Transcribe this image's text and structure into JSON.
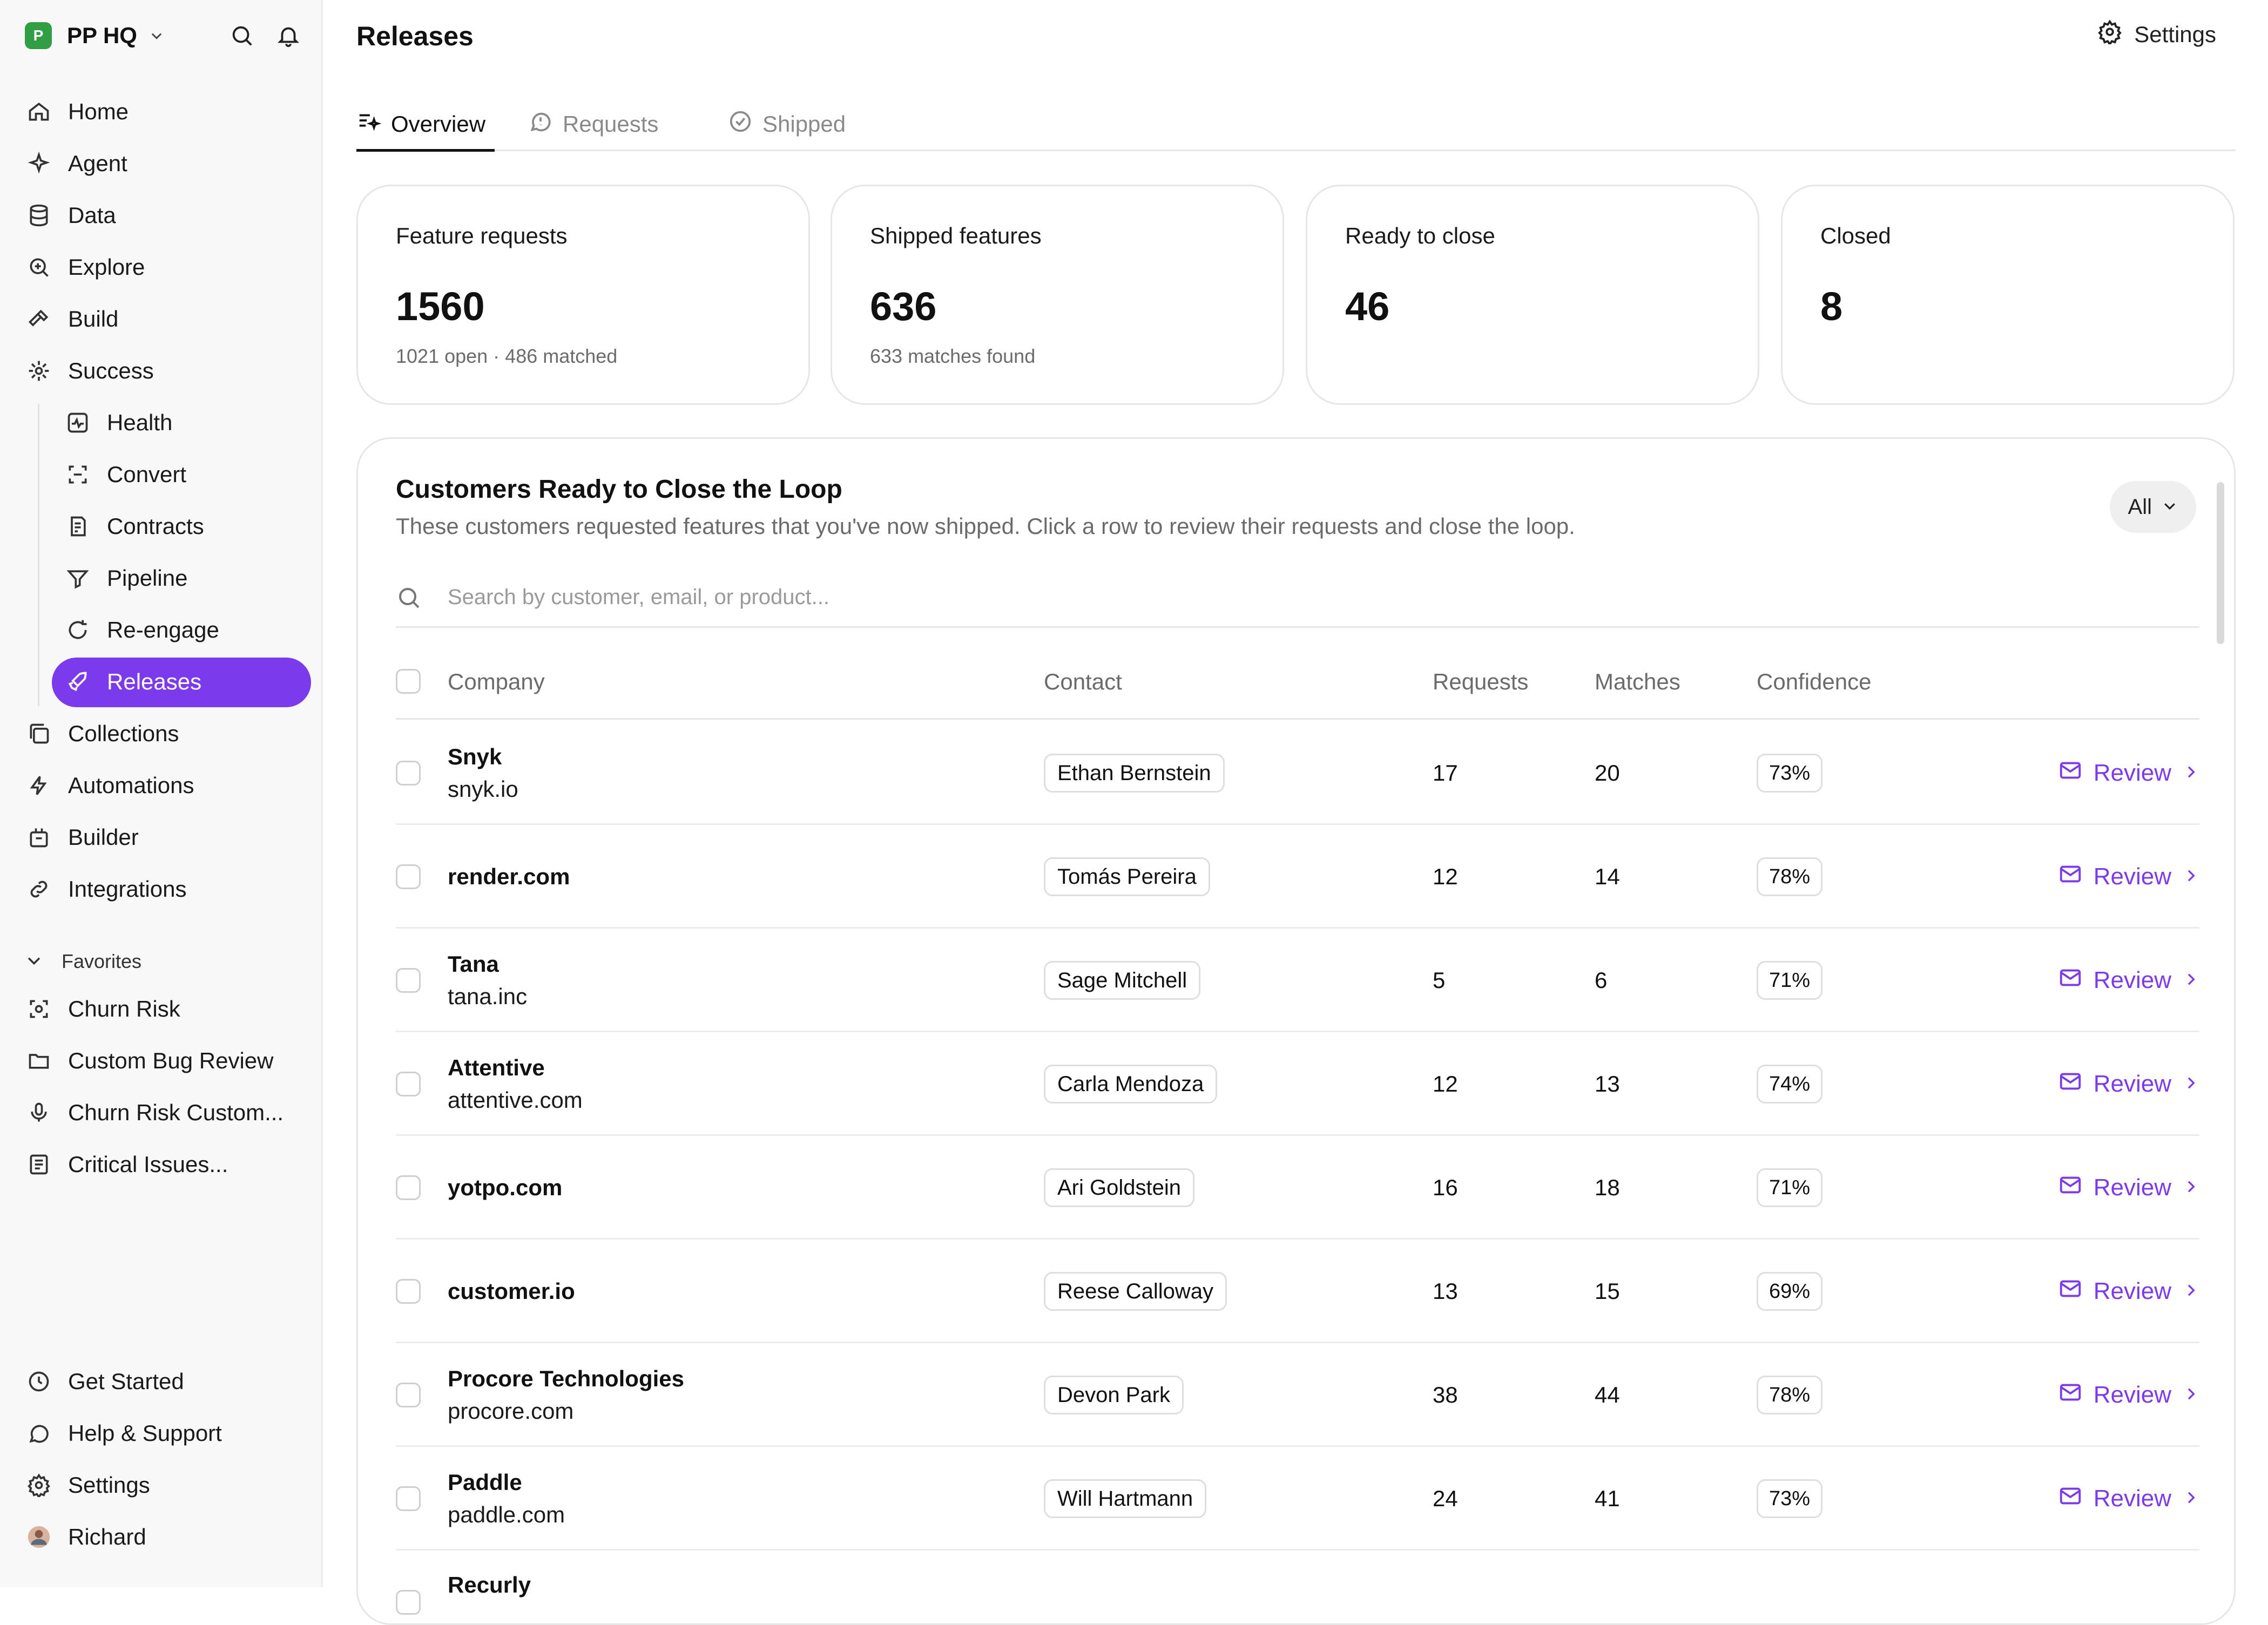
{
  "workspace": {
    "name": "PP HQ",
    "logo_letter": "P"
  },
  "sidebar": {
    "items": [
      {
        "label": "Home",
        "icon": "home-icon"
      },
      {
        "label": "Agent",
        "icon": "sparkle-icon"
      },
      {
        "label": "Data",
        "icon": "database-icon"
      },
      {
        "label": "Explore",
        "icon": "zoom-icon"
      },
      {
        "label": "Build",
        "icon": "hammer-icon"
      },
      {
        "label": "Success",
        "icon": "success-icon"
      }
    ],
    "sub_items": [
      {
        "label": "Health",
        "icon": "pulse-icon"
      },
      {
        "label": "Convert",
        "icon": "convert-icon"
      },
      {
        "label": "Contracts",
        "icon": "contract-icon"
      },
      {
        "label": "Pipeline",
        "icon": "funnel-icon"
      },
      {
        "label": "Re-engage",
        "icon": "reengage-icon"
      },
      {
        "label": "Releases",
        "icon": "rocket-icon",
        "active": true
      }
    ],
    "items2": [
      {
        "label": "Collections",
        "icon": "collections-icon"
      },
      {
        "label": "Automations",
        "icon": "automation-icon"
      },
      {
        "label": "Builder",
        "icon": "builder-icon"
      },
      {
        "label": "Integrations",
        "icon": "link-icon"
      }
    ],
    "favorites_label": "Favorites",
    "favorites": [
      {
        "label": "Churn Risk",
        "icon": "scan-icon"
      },
      {
        "label": "Custom Bug Review",
        "icon": "folder-icon"
      },
      {
        "label": "Churn Risk Custom...",
        "icon": "mic-icon"
      },
      {
        "label": "Critical Issues...",
        "icon": "document-icon"
      }
    ],
    "bottom": [
      {
        "label": "Get Started",
        "icon": "clock-icon"
      },
      {
        "label": "Help & Support",
        "icon": "chat-icon"
      },
      {
        "label": "Settings",
        "icon": "gear-icon"
      },
      {
        "label": "Richard",
        "icon": "avatar"
      }
    ]
  },
  "header": {
    "title": "Releases",
    "settings_label": "Settings"
  },
  "tabs": [
    {
      "label": "Overview",
      "icon": "overview-icon",
      "active": true
    },
    {
      "label": "Requests",
      "icon": "request-icon"
    },
    {
      "label": "Shipped",
      "icon": "check-circle-icon"
    }
  ],
  "stats": [
    {
      "title": "Feature requests",
      "value": "1560",
      "sub": "1021 open · 486 matched"
    },
    {
      "title": "Shipped features",
      "value": "636",
      "sub": "633 matches found"
    },
    {
      "title": "Ready to close",
      "value": "46",
      "sub": ""
    },
    {
      "title": "Closed",
      "value": "8",
      "sub": ""
    }
  ],
  "panel": {
    "title": "Customers Ready to Close the Loop",
    "description": "These customers requested features that you've now shipped. Click a row to review their requests and close the loop.",
    "filter_label": "All",
    "search_placeholder": "Search by customer, email, or product...",
    "columns": {
      "company": "Company",
      "contact": "Contact",
      "requests": "Requests",
      "matches": "Matches",
      "confidence": "Confidence"
    },
    "review_label": "Review",
    "rows": [
      {
        "name": "Snyk",
        "domain": "snyk.io",
        "contact": "Ethan Bernstein",
        "requests": "17",
        "matches": "20",
        "confidence": "73%"
      },
      {
        "name": "render.com",
        "domain": "",
        "contact": "Tomás Pereira",
        "requests": "12",
        "matches": "14",
        "confidence": "78%"
      },
      {
        "name": "Tana",
        "domain": "tana.inc",
        "contact": "Sage Mitchell",
        "requests": "5",
        "matches": "6",
        "confidence": "71%"
      },
      {
        "name": "Attentive",
        "domain": "attentive.com",
        "contact": "Carla Mendoza",
        "requests": "12",
        "matches": "13",
        "confidence": "74%"
      },
      {
        "name": "yotpo.com",
        "domain": "",
        "contact": "Ari Goldstein",
        "requests": "16",
        "matches": "18",
        "confidence": "71%"
      },
      {
        "name": "customer.io",
        "domain": "",
        "contact": "Reese Calloway",
        "requests": "13",
        "matches": "15",
        "confidence": "69%"
      },
      {
        "name": "Procore Technologies",
        "domain": "procore.com",
        "contact": "Devon Park",
        "requests": "38",
        "matches": "44",
        "confidence": "78%"
      },
      {
        "name": "Paddle",
        "domain": "paddle.com",
        "contact": "Will Hartmann",
        "requests": "24",
        "matches": "41",
        "confidence": "73%"
      },
      {
        "name": "Recurly",
        "domain": "",
        "contact": "",
        "requests": "",
        "matches": "",
        "confidence": ""
      }
    ]
  },
  "colors": {
    "accent": "#7c3aed",
    "logo": "#2f9e44"
  }
}
